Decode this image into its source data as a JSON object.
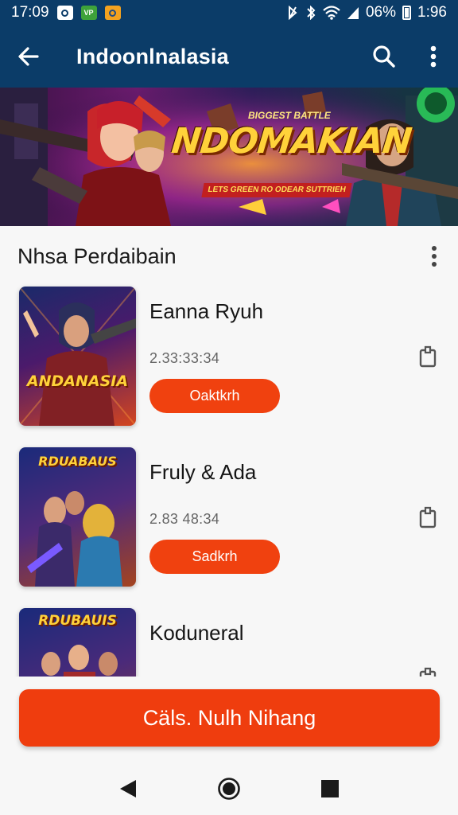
{
  "status_bar": {
    "time_left": "17:09",
    "battery_percent": "06%",
    "time_right": "1:96",
    "notifications": [
      "app-icon-white",
      "app-icon-green",
      "app-icon-orange"
    ]
  },
  "app_bar": {
    "title": "Indoonlnalasia",
    "back_icon": "arrow-left-icon",
    "search_icon": "search-icon",
    "menu_icon": "more-vert-icon"
  },
  "banner": {
    "title": "NDOMAKIAN",
    "top_text": "BIGGEST BATTLE",
    "tagline": "LETS GREEN RO ODEAR SUTTRIEH"
  },
  "section": {
    "title": "Nhsa Perdaibain",
    "more_icon": "more-vert-icon"
  },
  "games": [
    {
      "name": "Eanna Ryuh",
      "meta": "2.33:33:34",
      "button": "Oaktkrh",
      "thumb_label": "ANDANASIA",
      "share_icon": "share-icon"
    },
    {
      "name": "Fruly & Ada",
      "meta": "2.83 48:34",
      "button": "Sadkrh",
      "thumb_label": "RDUABAUS",
      "share_icon": "share-icon"
    },
    {
      "name": "Koduneral",
      "meta": "",
      "button": "",
      "thumb_label": "RDUBAUIS",
      "share_icon": "share-icon"
    }
  ],
  "cta": {
    "label": "Cäls. Nulh Nihang"
  },
  "nav": {
    "back_icon": "nav-back-icon",
    "home_icon": "nav-home-icon",
    "recents_icon": "nav-recents-icon"
  },
  "colors": {
    "primary": "#0b3c68",
    "accent": "#ef3d0e",
    "background": "#f7f7f7"
  }
}
